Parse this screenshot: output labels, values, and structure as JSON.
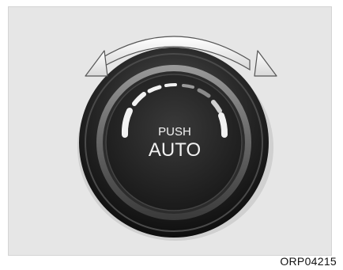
{
  "knob": {
    "line1": "PUSH",
    "line2": "AUTO"
  },
  "figure_code": "ORP04215",
  "colors": {
    "background": "#e6e6e6",
    "knob_outer": "#222222",
    "knob_ring": "#6f6f6f",
    "knob_face": "#262626",
    "indicator_arc": "#f2f2f2",
    "arrow_fill": "#ffffff"
  },
  "icons": {
    "rotation": "double-headed-curved-arrow-icon"
  }
}
